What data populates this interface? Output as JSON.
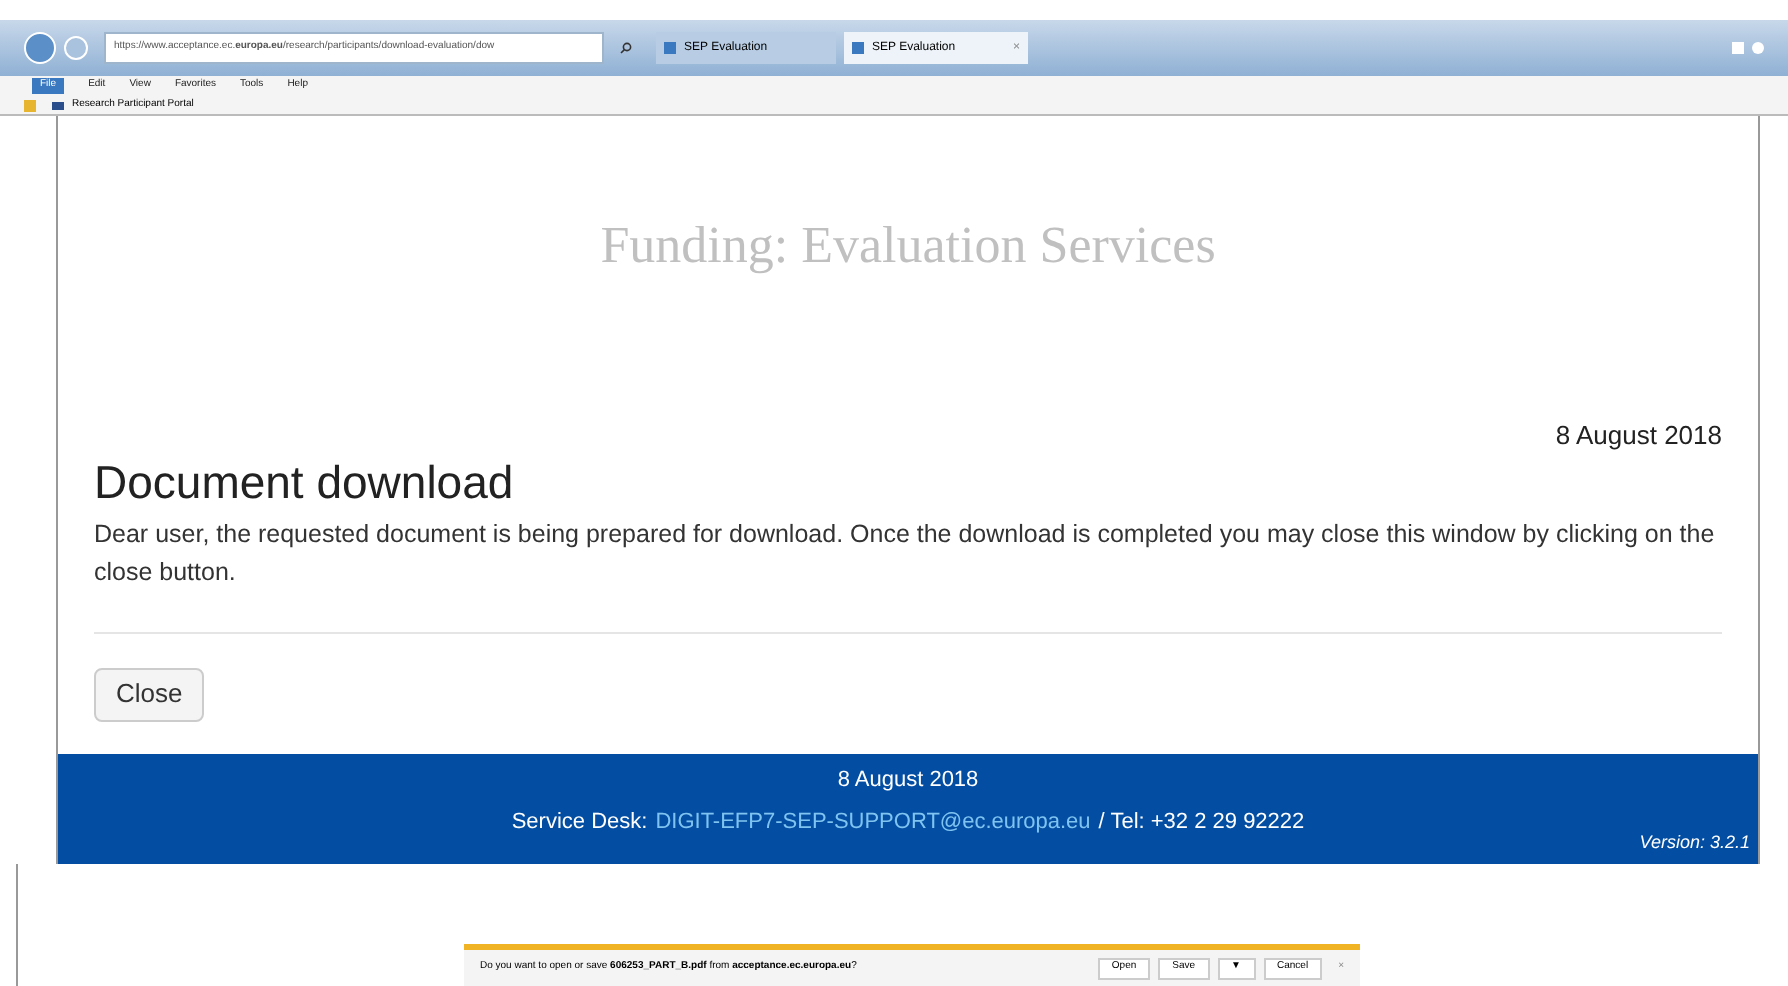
{
  "browser": {
    "address": "https://www.acceptance.ec.**europa.eu**/research/participants/download-evaluation/dow",
    "tabs": [
      {
        "label": "SEP Evaluation",
        "selected": false
      },
      {
        "label": "SEP Evaluation",
        "selected": true,
        "close": "×"
      }
    ],
    "menu": [
      {
        "label": "File",
        "selected": true
      },
      {
        "label": "Edit",
        "selected": false
      },
      {
        "label": "View",
        "selected": false
      },
      {
        "label": "Favorites",
        "selected": false
      },
      {
        "label": "Tools",
        "selected": false
      },
      {
        "label": "Help",
        "selected": false
      }
    ],
    "favorites": [
      "Research Participant Portal"
    ]
  },
  "page": {
    "banner": "Funding: Evaluation Services",
    "date": "8 August 2018",
    "title": "Document download",
    "message": "Dear user, the requested document is being prepared for download. Once the download is completed you may close this window by clicking on the close button.",
    "button": "Close"
  },
  "footer": {
    "date": "8 August 2018",
    "desk_label": "Service Desk:",
    "email": "DIGIT-EFP7-SEP-SUPPORT@ec.europa.eu",
    "tel": "/ Tel: +32 2 29 92222",
    "version": "Version: 3.2.1"
  },
  "download_bar": {
    "message": "Do you want to open or save **606253_PART_B.pdf** from **acceptance.ec.europa.eu**?",
    "buttons": [
      "Open",
      "Save",
      "▼",
      "Cancel"
    ],
    "close": "×"
  }
}
